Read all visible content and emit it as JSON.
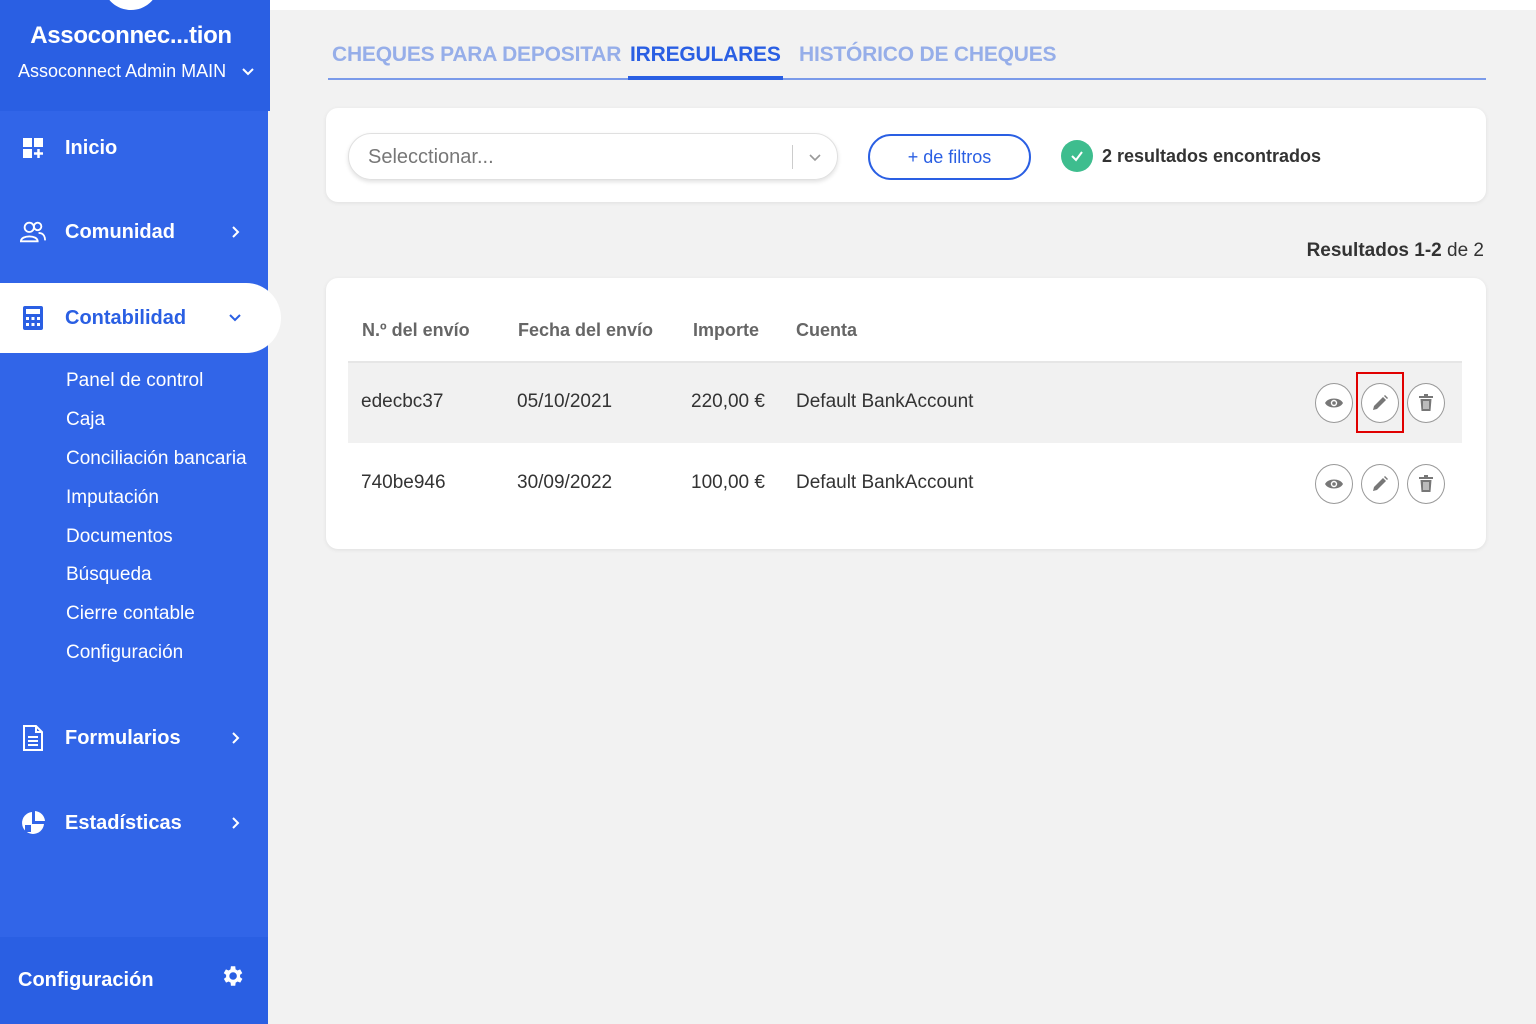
{
  "org": {
    "name": "Assoconnec...tion",
    "account": "Assoconnect Admin MAIN"
  },
  "nav": {
    "inicio": "Inicio",
    "comunidad": "Comunidad",
    "contabilidad": "Contabilidad",
    "formularios": "Formularios",
    "estadisticas": "Estadísticas"
  },
  "subnav": [
    "Panel de control",
    "Caja",
    "Conciliación bancaria",
    "Imputación",
    "Documentos",
    "Búsqueda",
    "Cierre contable",
    "Configuración"
  ],
  "footer": {
    "label": "Configuración"
  },
  "tabs": [
    "CHEQUES PARA DEPOSITAR",
    "IRREGULARES",
    "HISTÓRICO DE CHEQUES"
  ],
  "active_tab": "IRREGULARES",
  "filters": {
    "select_placeholder": "Selecctionar...",
    "more_filters": "+ de filtros",
    "results_found": "2 resultados encontrados"
  },
  "pagination": {
    "label": "Resultados 1-2",
    "of": "de 2"
  },
  "table": {
    "headers": [
      "N.º del envío",
      "Fecha del envío",
      "Importe",
      "Cuenta"
    ],
    "rows": [
      {
        "id": "edecbc37",
        "date": "05/10/2021",
        "amount": "220,00 €",
        "account": "Default BankAccount"
      },
      {
        "id": "740be946",
        "date": "30/09/2022",
        "amount": "100,00 €",
        "account": "Default BankAccount"
      }
    ]
  },
  "colors": {
    "sidebar": "#3165e8",
    "accent": "#2a5fe3",
    "success": "#3ebd8e",
    "highlight": "#e00000"
  },
  "icons": [
    "dashboard-icon",
    "community-icon",
    "calculator-icon",
    "form-icon",
    "stats-icon",
    "gear-icon",
    "eye-icon",
    "pencil-icon",
    "trash-icon",
    "check-icon",
    "chevron-down-icon",
    "chevron-right-icon"
  ]
}
